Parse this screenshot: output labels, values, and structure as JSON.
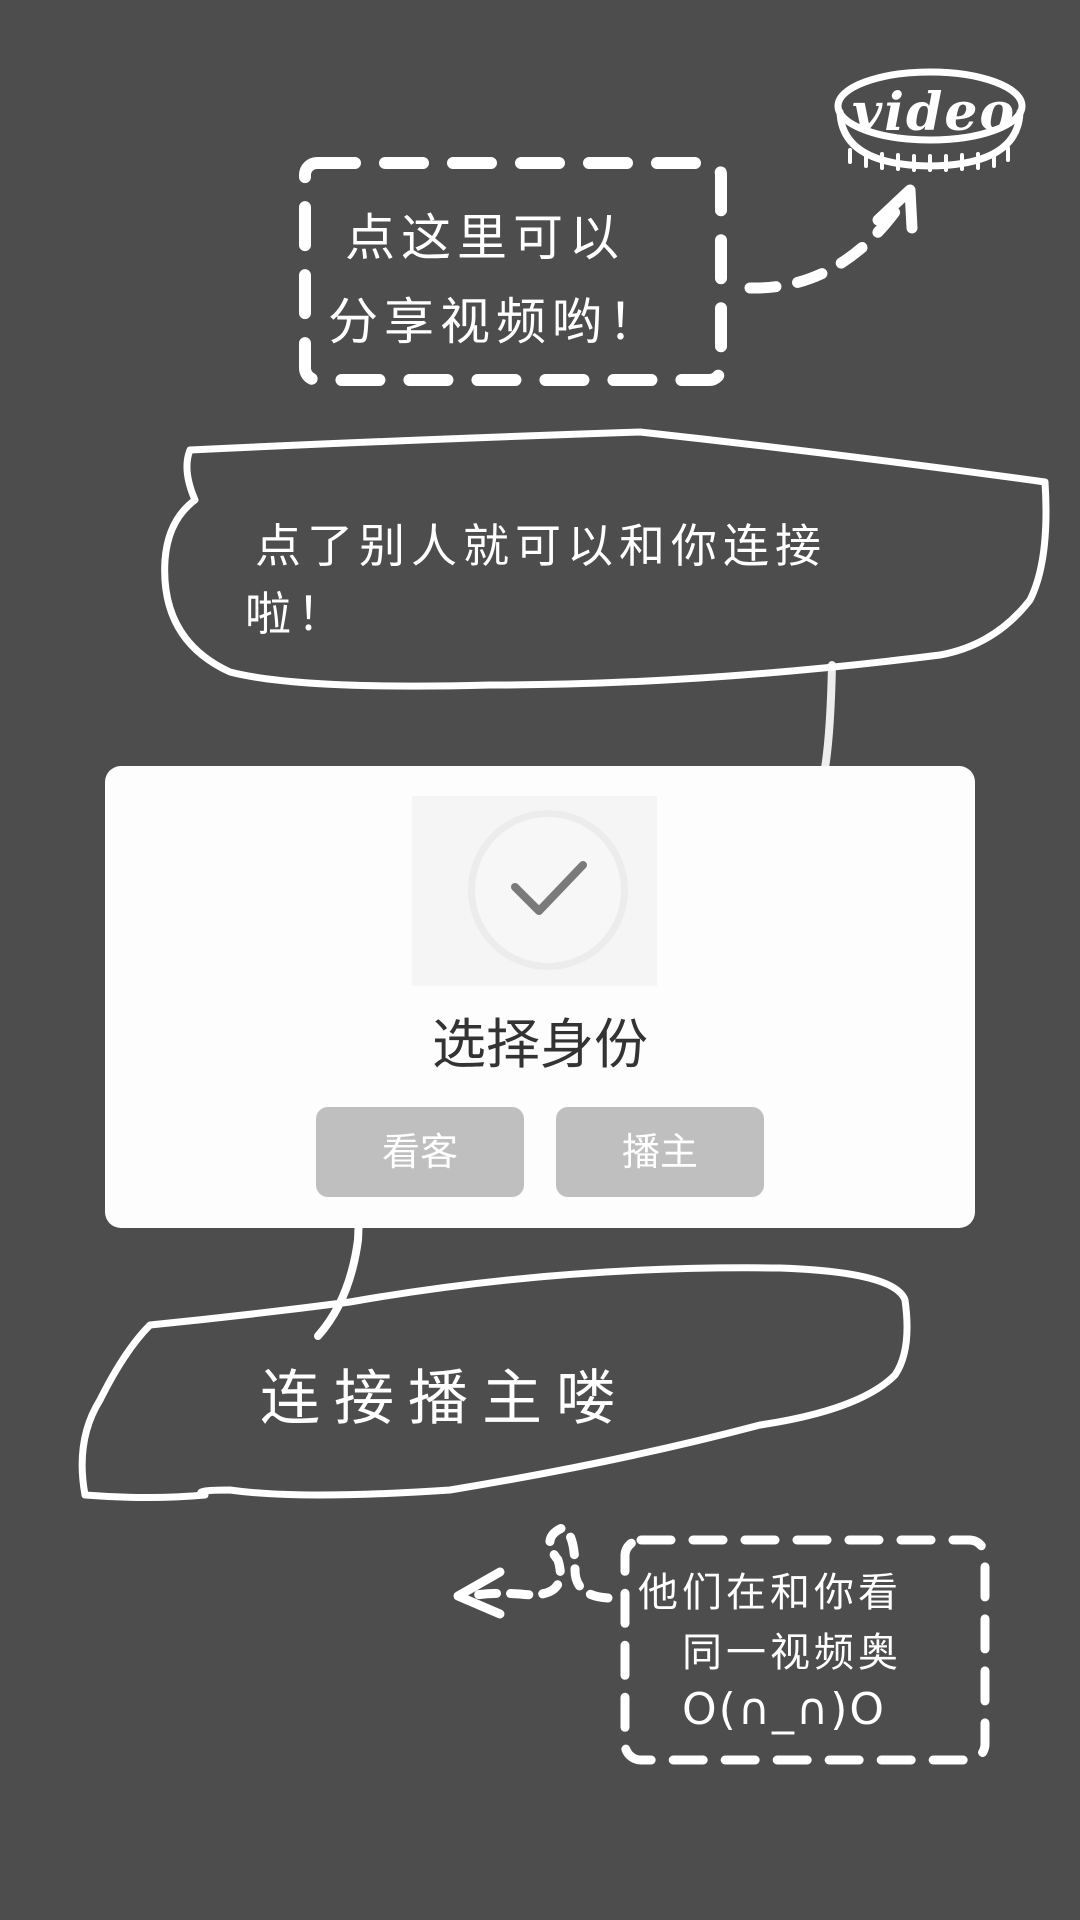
{
  "video_button": {
    "label": "video"
  },
  "hints": {
    "share": [
      "点这里可以",
      "分享视频哟！"
    ],
    "connect": [
      "点了别人就可以和你连接",
      "啦！"
    ],
    "host": "连接播主喽",
    "same_video": [
      "他们在和你看",
      "同一视频奥",
      "O(∩_∩)O"
    ]
  },
  "dialog": {
    "title": "选择身份",
    "buttons": {
      "viewer": "看客",
      "host": "播主"
    }
  },
  "colors": {
    "background": "#4d4d4d",
    "dialog": "#fdfdfd",
    "button": "#bfbfbf",
    "check": "#7a7a7a"
  },
  "icons": {
    "check": "check-icon",
    "arrows": "arrow-icon"
  }
}
